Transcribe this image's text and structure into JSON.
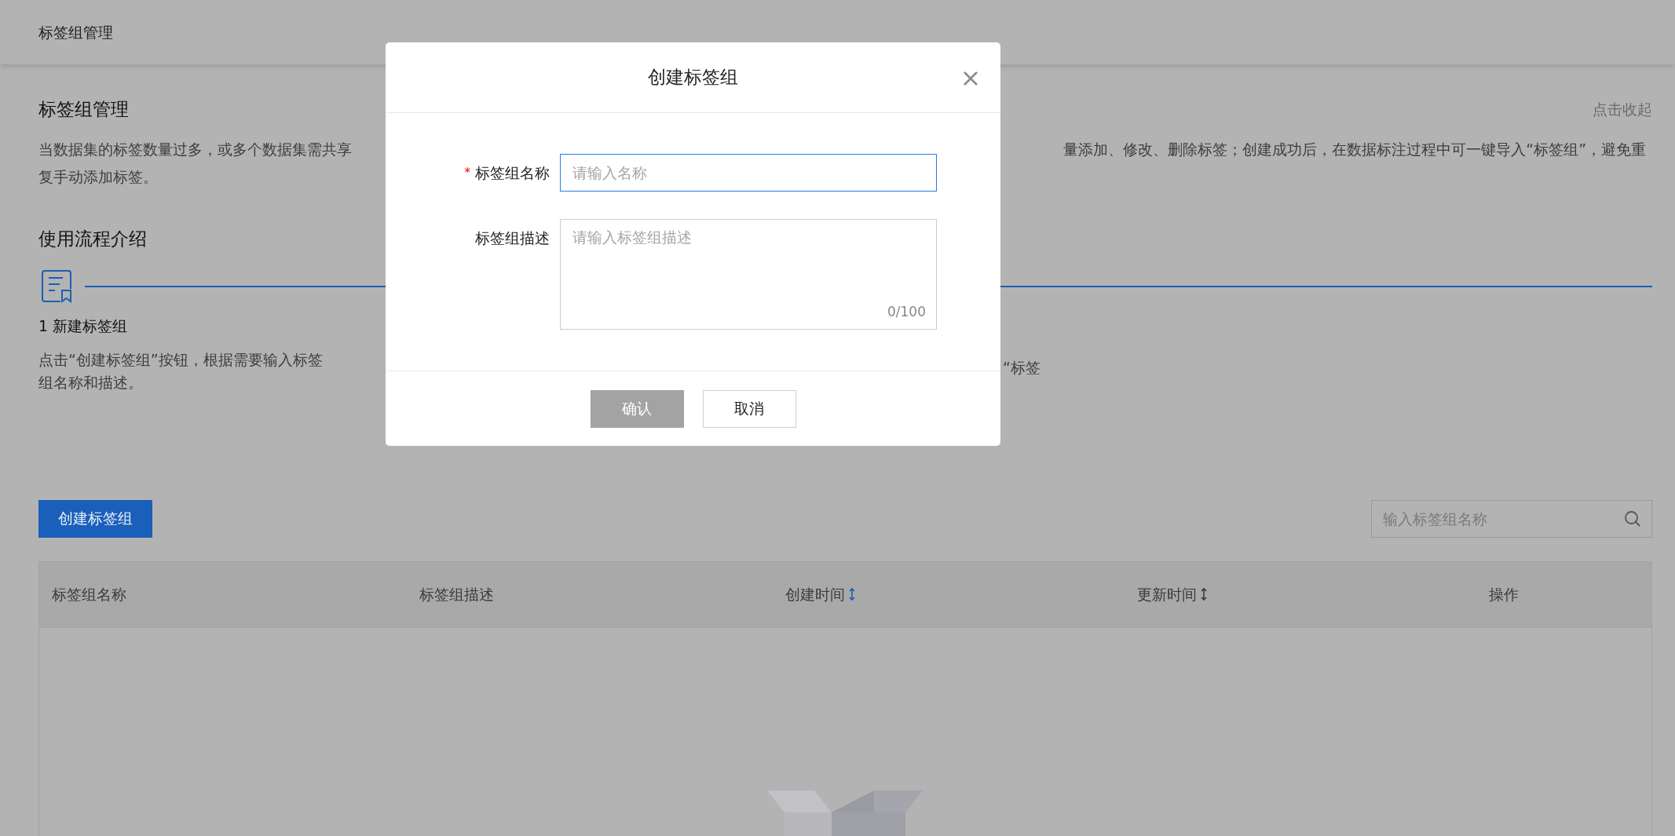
{
  "header": {
    "title": "标签组管理"
  },
  "intro": {
    "title": "标签组管理",
    "collapse_link": "点击收起",
    "description_left": "当数据集的标签数量过多，或多个数据集需共享",
    "description_right": "量添加、修改、删除标签；创建成功后，在数据标注过程中可一键导入“标签组”，避免重",
    "description_line2": "复手动添加标签。"
  },
  "workflow": {
    "title": "使用流程介绍",
    "steps": [
      {
        "title": "1 新建标签组",
        "text": "点击“创建标签组”按钮，根据需要输入标签组名称和描述。"
      },
      {
        "text": "“标签"
      }
    ]
  },
  "toolbar": {
    "create_button": "创建标签组",
    "search": {
      "placeholder": "输入标签组名称"
    }
  },
  "table": {
    "columns": [
      {
        "label": "标签组名称",
        "kind": "plain"
      },
      {
        "label": "标签组描述",
        "kind": "plain"
      },
      {
        "label": "创建时间",
        "kind": "sortable",
        "sorted": true
      },
      {
        "label": "更新时间",
        "kind": "sortable",
        "sorted": false
      },
      {
        "label": "操作",
        "kind": "plain"
      }
    ]
  },
  "dialog": {
    "title": "创建标签组",
    "required_mark": "*",
    "fields": [
      {
        "label": "标签组名称",
        "kind": "input",
        "required": true,
        "focused": true,
        "placeholder": "请输入名称"
      },
      {
        "label": "标签组描述",
        "kind": "textarea",
        "required": false,
        "focused": false,
        "placeholder": "请输入标签组描述",
        "counter": "0/100"
      }
    ],
    "buttons": [
      {
        "label": "确认",
        "kind": "primary",
        "disabled": true
      },
      {
        "label": "取消",
        "kind": "default",
        "disabled": false
      }
    ]
  }
}
